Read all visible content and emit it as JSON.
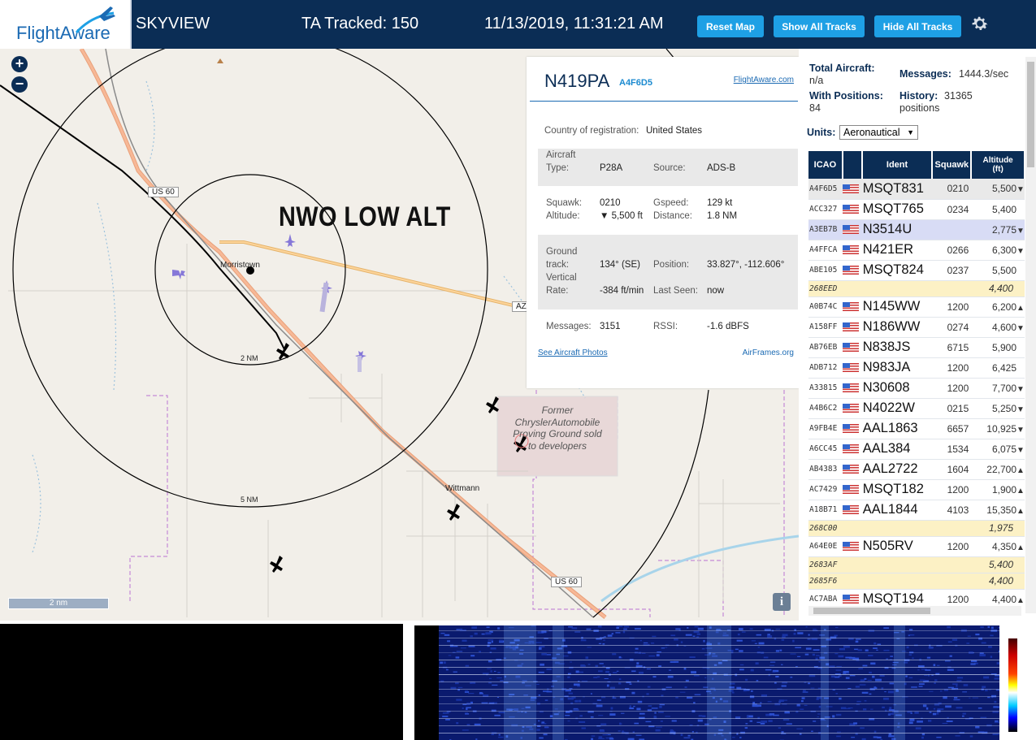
{
  "header": {
    "logo_text": "FlightAware",
    "app_name": "SKYVIEW",
    "ta_tracked": "TA Tracked: 150",
    "datetime": "11/13/2019, 11:31:21 AM",
    "reset_map": "Reset Map",
    "show_all_tracks": "Show All Tracks",
    "hide_all_tracks": "Hide All Tracks",
    "settings_icon": "gear-icon"
  },
  "map": {
    "zoom_in": "+",
    "zoom_out": "−",
    "overlay_title": "NWO LOW ALT",
    "place_morristown": "Morristown",
    "place_wittmann": "Wittmann",
    "ring_2nm": "2 NM",
    "ring_5nm": "5 NM",
    "road_us60_a": "US 60",
    "road_us60_b": "US 60",
    "road_az": "AZ",
    "landmark_text": "Former ChryslerAutomobile Proving Ground sold to developers",
    "scale_label": "2 nm",
    "info_button": "i"
  },
  "popup": {
    "ident": "N419PA",
    "hex": "A4F6D5",
    "flightaware_link": "FlightAware.com",
    "country_label": "Country of registration:",
    "country_value": "United States",
    "aircraft_label": "Aircraft",
    "type_label": "Type:",
    "type_value": "P28A",
    "source_label": "Source:",
    "source_value": "ADS-B",
    "squawk_label": "Squawk:",
    "squawk_value": "0210",
    "gspeed_label": "Gspeed:",
    "gspeed_value": "129 kt",
    "altitude_label": "Altitude:",
    "altitude_value": "▼ 5,500 ft",
    "distance_label": "Distance:",
    "distance_value": "1.8 NM",
    "ground_label": "Ground",
    "track_label": "track:",
    "track_value": "134° (SE)",
    "position_label": "Position:",
    "position_value": "33.827°, -112.606°",
    "vertical_label": "Vertical",
    "rate_label": "Rate:",
    "rate_value": "-384 ft/min",
    "lastseen_label": "Last Seen:",
    "lastseen_value": "now",
    "messages_label": "Messages:",
    "messages_value": "3151",
    "rssi_label": "RSSI:",
    "rssi_value": "-1.6 dBFS",
    "photos_link": "See Aircraft Photos",
    "airframes_link": "AirFrames.org"
  },
  "sidebar": {
    "total_aircraft_label": "Total Aircraft:",
    "total_aircraft_value": "n/a",
    "messages_label": "Messages:",
    "messages_value": "1444.3/sec",
    "with_positions_label": "With Positions:",
    "with_positions_value": "84",
    "history_label": "History:",
    "history_value": "31365",
    "history_unit": "positions",
    "units_label": "Units:",
    "units_value": "Aeronautical",
    "columns": [
      "ICAO",
      "Ident",
      "Squawk",
      "Altitude (ft)"
    ],
    "rows": [
      {
        "icao": "A4F6D5",
        "flag": true,
        "ident": "MSQT831",
        "squawk": "0210",
        "altitude": "5,500",
        "arrow": "▼",
        "style": "hl"
      },
      {
        "icao": "ACC327",
        "flag": true,
        "ident": "MSQT765",
        "squawk": "0234",
        "altitude": "5,400",
        "arrow": "",
        "style": ""
      },
      {
        "icao": "A3EB7B",
        "flag": true,
        "ident": "N3514U",
        "squawk": "",
        "altitude": "2,775",
        "arrow": "▼",
        "style": "sel"
      },
      {
        "icao": "A4FFCA",
        "flag": true,
        "ident": "N421ER",
        "squawk": "0266",
        "altitude": "6,300",
        "arrow": "▼",
        "style": ""
      },
      {
        "icao": "ABE105",
        "flag": true,
        "ident": "MSQT824",
        "squawk": "0237",
        "altitude": "5,500",
        "arrow": "",
        "style": ""
      },
      {
        "icao": "268EED",
        "flag": false,
        "ident": "",
        "squawk": "",
        "altitude": "4,400",
        "arrow": "",
        "style": "y"
      },
      {
        "icao": "A0B74C",
        "flag": true,
        "ident": "N145WW",
        "squawk": "1200",
        "altitude": "6,200",
        "arrow": "▲",
        "style": ""
      },
      {
        "icao": "A158FF",
        "flag": true,
        "ident": "N186WW",
        "squawk": "0274",
        "altitude": "4,600",
        "arrow": "▼",
        "style": ""
      },
      {
        "icao": "AB76EB",
        "flag": true,
        "ident": "N838JS",
        "squawk": "6715",
        "altitude": "5,900",
        "arrow": "",
        "style": ""
      },
      {
        "icao": "ADB712",
        "flag": true,
        "ident": "N983JA",
        "squawk": "1200",
        "altitude": "6,425",
        "arrow": "",
        "style": ""
      },
      {
        "icao": "A33815",
        "flag": true,
        "ident": "N30608",
        "squawk": "1200",
        "altitude": "7,700",
        "arrow": "▼",
        "style": ""
      },
      {
        "icao": "A4B6C2",
        "flag": true,
        "ident": "N4022W",
        "squawk": "0215",
        "altitude": "5,250",
        "arrow": "▼",
        "style": ""
      },
      {
        "icao": "A9FB4E",
        "flag": true,
        "ident": "AAL1863",
        "squawk": "6657",
        "altitude": "10,925",
        "arrow": "▼",
        "style": ""
      },
      {
        "icao": "A6CC45",
        "flag": true,
        "ident": "AAL384",
        "squawk": "1534",
        "altitude": "6,075",
        "arrow": "▼",
        "style": ""
      },
      {
        "icao": "AB4383",
        "flag": true,
        "ident": "AAL2722",
        "squawk": "1604",
        "altitude": "22,700",
        "arrow": "▲",
        "style": ""
      },
      {
        "icao": "AC7429",
        "flag": true,
        "ident": "MSQT182",
        "squawk": "1200",
        "altitude": "1,900",
        "arrow": "▲",
        "style": ""
      },
      {
        "icao": "A18B71",
        "flag": true,
        "ident": "AAL1844",
        "squawk": "4103",
        "altitude": "15,350",
        "arrow": "▲",
        "style": ""
      },
      {
        "icao": "268C00",
        "flag": false,
        "ident": "",
        "squawk": "",
        "altitude": "1,975",
        "arrow": "",
        "style": "y"
      },
      {
        "icao": "A64E0E",
        "flag": true,
        "ident": "N505RV",
        "squawk": "1200",
        "altitude": "4,350",
        "arrow": "▲",
        "style": ""
      },
      {
        "icao": "2683AF",
        "flag": false,
        "ident": "",
        "squawk": "",
        "altitude": "5,400",
        "arrow": "",
        "style": "y"
      },
      {
        "icao": "2685F6",
        "flag": false,
        "ident": "",
        "squawk": "",
        "altitude": "4,400",
        "arrow": "",
        "style": "y"
      },
      {
        "icao": "AC7ABA",
        "flag": true,
        "ident": "MSQT194",
        "squawk": "1200",
        "altitude": "4,400",
        "arrow": "▲",
        "style": ""
      }
    ]
  },
  "colors": {
    "header_bg": "#0b2d55",
    "button_bg": "#1ea0e5",
    "selected_row": "#d8dcf5",
    "unknown_row": "#fcf1c5"
  }
}
